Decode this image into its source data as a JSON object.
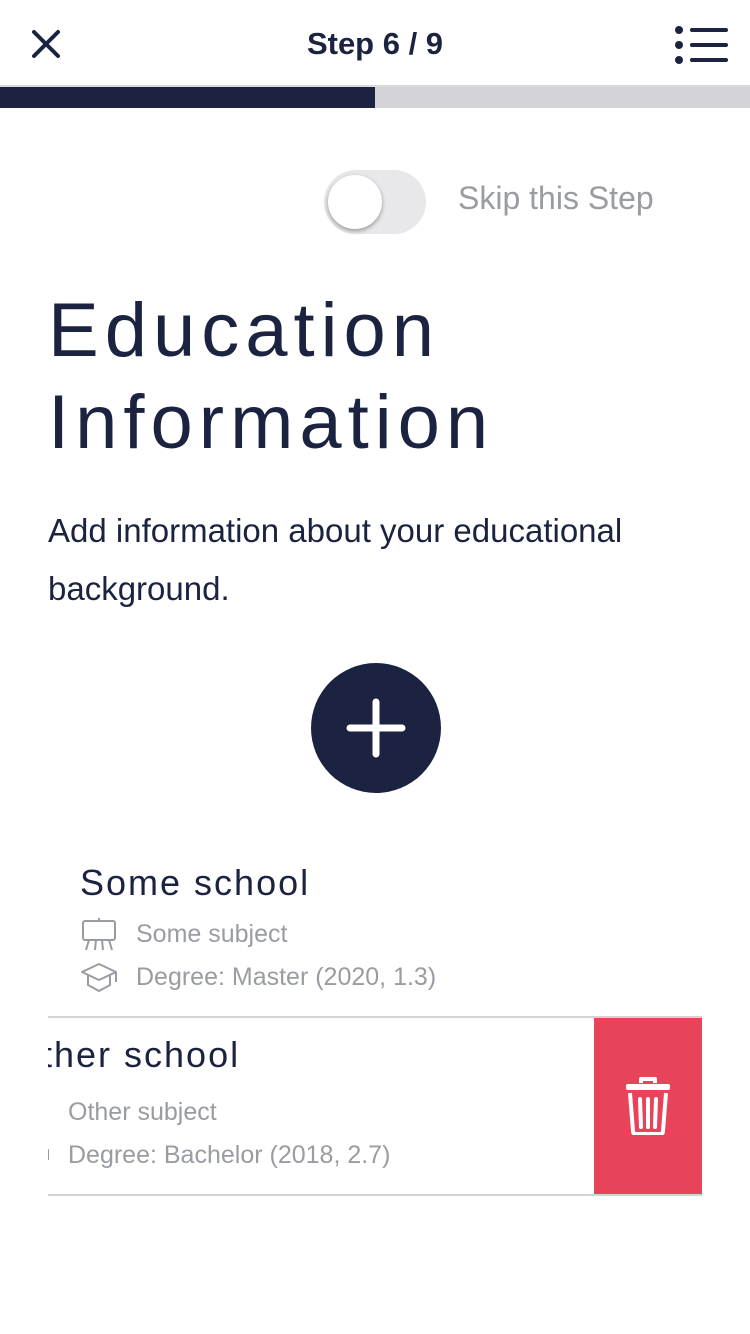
{
  "header": {
    "step_label": "Step 6 / 9",
    "close_icon": "close-icon",
    "menu_icon": "list-menu-icon"
  },
  "progress": {
    "current": 6,
    "total": 9,
    "fraction": 0.5
  },
  "skip": {
    "label": "Skip this Step",
    "enabled": false
  },
  "page": {
    "title_line1": "Education",
    "title_line2": "Information",
    "description": "Add information about your educational background."
  },
  "add_button": {
    "icon": "plus-icon"
  },
  "entries": [
    {
      "school": "Some school",
      "subject": "Some subject",
      "degree": "Degree: Master (2020, 1.3)",
      "subject_icon": "easel-icon",
      "degree_icon": "graduation-cap-icon"
    },
    {
      "school": "Other school",
      "subject": "Other subject",
      "degree": "Degree: Bachelor (2018, 2.7)",
      "subject_icon": "easel-icon",
      "degree_icon": "graduation-cap-icon",
      "swiped_open": true
    }
  ],
  "delete_action": {
    "icon": "trash-icon"
  },
  "colors": {
    "primary": "#1b2340",
    "muted": "#9a9ca3",
    "progress_track": "#d3d3d9",
    "delete": "#e84459"
  }
}
